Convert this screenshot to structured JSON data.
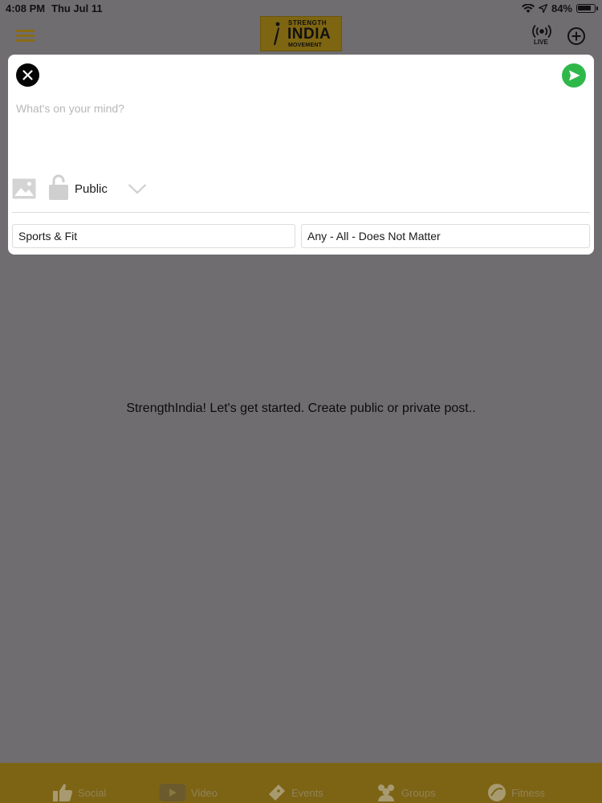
{
  "status_bar": {
    "time": "4:08 PM",
    "date": "Thu Jul 11",
    "battery_pct": "84%",
    "battery_level": 0.84
  },
  "header": {
    "logo": {
      "line1": "STRENGTH",
      "line2": "INDIA",
      "line3": "MOVEMENT"
    },
    "live_label": "LIVE"
  },
  "composer": {
    "placeholder": "What's on your mind?",
    "text": "",
    "privacy": "Public",
    "category": "Sports & Fit",
    "audience": "Any - All - Does Not Matter"
  },
  "empty_state": {
    "message": "StrengthIndia! Let's get started. Create public or private post.."
  },
  "tabs": [
    {
      "label": "Social",
      "icon": "thumbs-up-icon"
    },
    {
      "label": "Video",
      "icon": "video-icon"
    },
    {
      "label": "Events",
      "icon": "ticket-icon"
    },
    {
      "label": "Groups",
      "icon": "groups-icon"
    },
    {
      "label": "Fitness",
      "icon": "fitness-icon"
    }
  ],
  "colors": {
    "overlay_bg": "#6f6d70",
    "brand_gold": "#7d6415",
    "send_green": "#2fb84a",
    "card_bg": "#ffffff"
  }
}
